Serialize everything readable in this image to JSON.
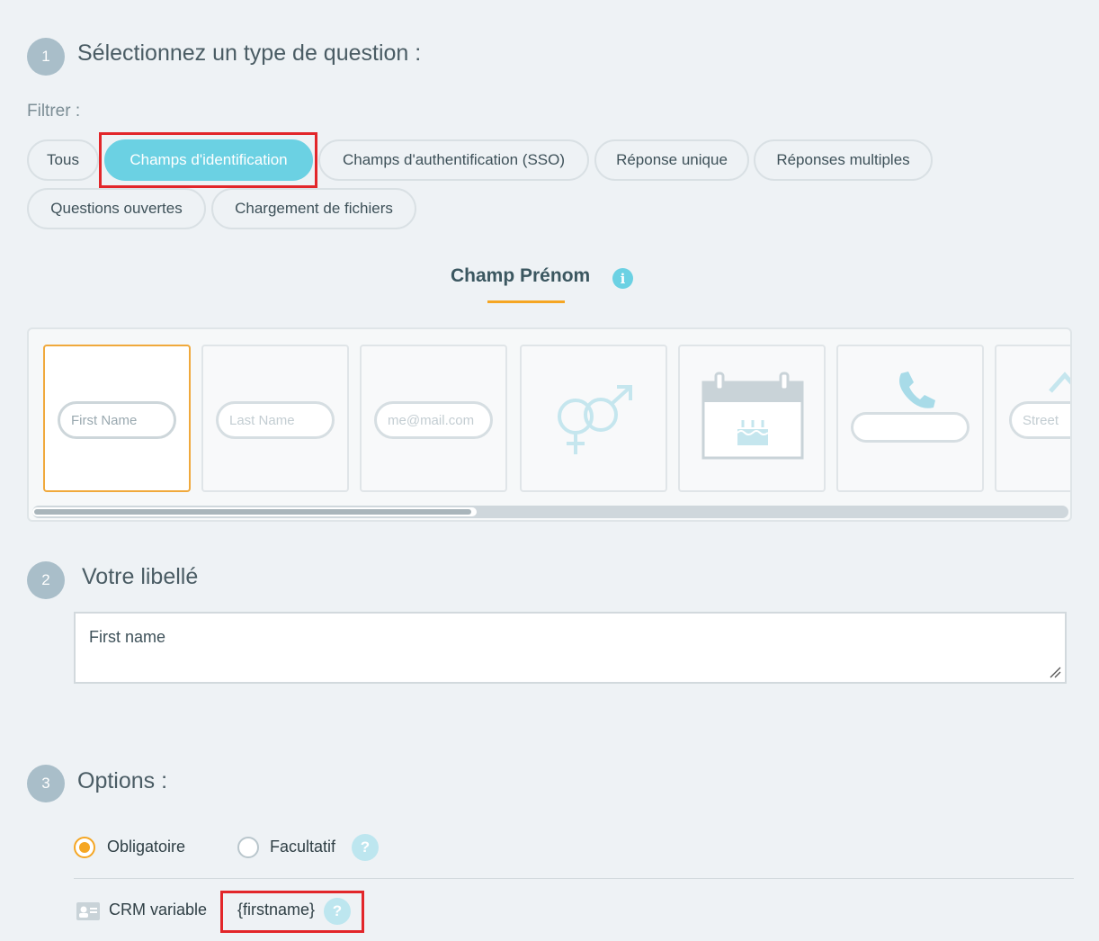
{
  "step1": {
    "number": "1",
    "title": "Sélectionnez un type de question :"
  },
  "filter": {
    "label": "Filtrer :",
    "chips": [
      "Tous",
      "Champs d'identification",
      "Champs d'authentification (SSO)",
      "Réponse unique",
      "Réponses multiples",
      "Questions ouvertes",
      "Chargement de fichiers"
    ],
    "active_index": 1
  },
  "field_type": {
    "title": "Champ Prénom",
    "info": "i",
    "cards": [
      {
        "name": "first-name",
        "placeholder": "First Name",
        "selected": true
      },
      {
        "name": "last-name",
        "placeholder": "Last Name"
      },
      {
        "name": "email",
        "placeholder": "me@mail.com"
      },
      {
        "name": "gender",
        "icon": "gender-icon"
      },
      {
        "name": "birthday",
        "icon": "calendar-cake-icon"
      },
      {
        "name": "phone",
        "icon": "phone-icon"
      },
      {
        "name": "address",
        "placeholder": "Street",
        "icon": "house-icon"
      }
    ]
  },
  "step2": {
    "number": "2",
    "title": "Votre libellé",
    "label_value": "First name"
  },
  "step3": {
    "number": "3",
    "title": "Options :",
    "required_label": "Obligatoire",
    "optional_label": "Facultatif",
    "selected": "Obligatoire",
    "help": "?",
    "crm_label": "CRM variable",
    "crm_value": "{firstname}",
    "crm_icon": "contact-card-icon"
  },
  "colors": {
    "accent": "#6bd1e3",
    "orange": "#f5a623",
    "highlight": "#e2262a"
  }
}
